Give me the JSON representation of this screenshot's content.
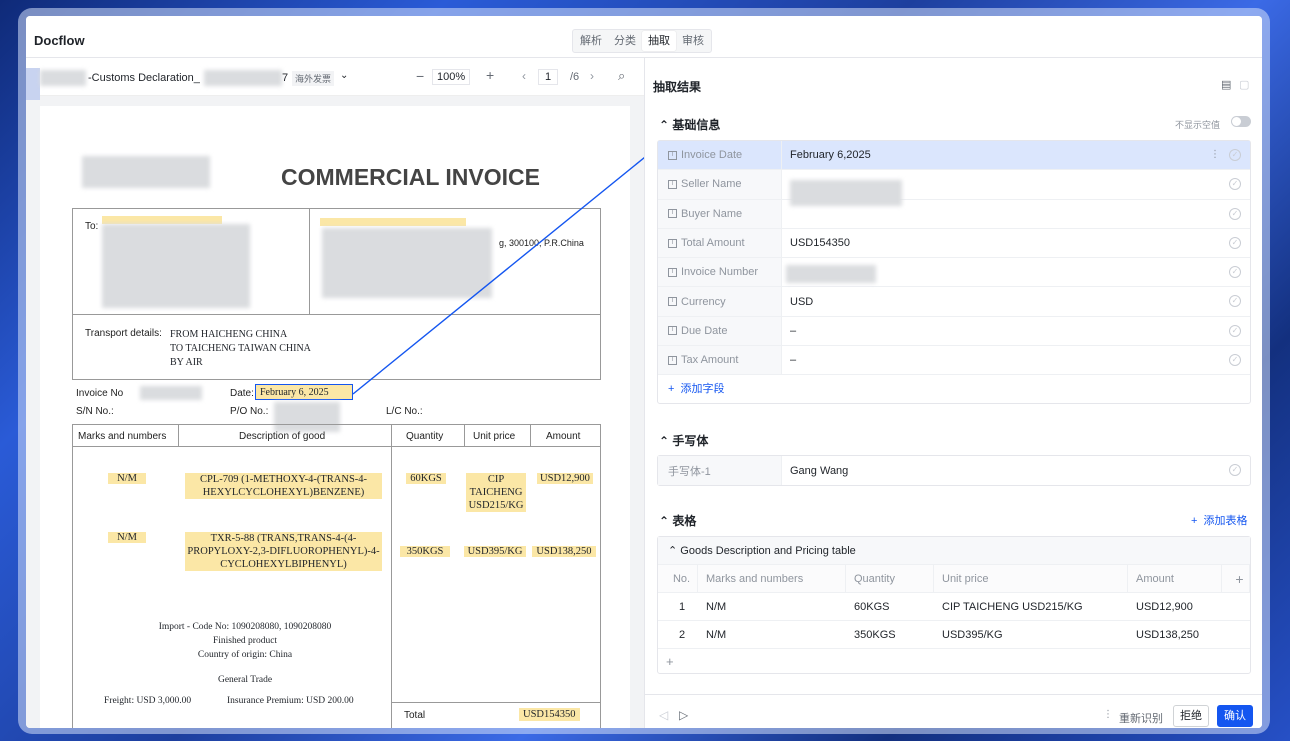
{
  "app": {
    "title": "Docflow",
    "tabs": [
      "解析",
      "分类",
      "抽取",
      "审核"
    ],
    "active_tab": "抽取"
  },
  "viewer": {
    "file_name": "-Customs Declaration_",
    "file_suffix": "7",
    "tag": "海外发票",
    "zoom": "100%",
    "page_current": "1",
    "page_total": "/6"
  },
  "invoice": {
    "title": "COMMERCIAL INVOICE",
    "to_label": "To:",
    "address_fragment": "g, 300100, P.R.China",
    "transport_label": "Transport details:",
    "transport_lines": [
      "FROM HAICHENG CHINA",
      "TO TAICHENG TAIWAN CHINA",
      "BY AIR"
    ],
    "invoice_no_label": "Invoice No",
    "date_label": "Date:",
    "date_value": "February 6, 2025",
    "sn_label": "S/N No.:",
    "po_label": "P/O No.:",
    "lc_label": "L/C No.:",
    "headers": [
      "Marks and numbers",
      "Description of good",
      "Quantity",
      "Unit price",
      "Amount"
    ],
    "items": [
      {
        "marks": "N/M",
        "desc": "CPL-709 (1-METHOXY-4-(TRANS-4-HEXYLCYCLOHEXYL)BENZENE)",
        "qty": "60KGS",
        "price": "CIP TAICHENG USD215/KG",
        "amount": "USD12,900"
      },
      {
        "marks": "N/M",
        "desc": "TXR-5-88 (TRANS,TRANS-4-(4-PROPYLOXY-2,3-DIFLUOROPHENYL)-4-CYCLOHEXYLBIPHENYL)",
        "qty": "350KGS",
        "price": "USD395/KG",
        "amount": "USD138,250"
      }
    ],
    "notes": [
      "Import - Code No: 1090208080, 1090208080",
      "Finished product",
      "Country of origin: China",
      "General Trade"
    ],
    "freight": "Freight: USD 3,000.00",
    "insurance": "Insurance Premium: USD 200.00",
    "total_label": "Total",
    "total_value": "USD154350"
  },
  "panel": {
    "title": "抽取结果",
    "basic_section": "基础信息",
    "hide_empty": "不显示空值",
    "fields": [
      {
        "label": "Invoice Date",
        "value": "February 6,2025"
      },
      {
        "label": "Seller Name",
        "value": ""
      },
      {
        "label": "Buyer Name",
        "value": ""
      },
      {
        "label": "Total Amount",
        "value": "USD154350"
      },
      {
        "label": "Invoice Number",
        "value": ""
      },
      {
        "label": "Currency",
        "value": "USD"
      },
      {
        "label": "Due Date",
        "value": "–"
      },
      {
        "label": "Tax Amount",
        "value": "–"
      }
    ],
    "add_field": "添加字段",
    "handwriting_section": "手写体",
    "handwriting": {
      "label": "手写体-1",
      "value": "Gang Wang"
    },
    "table_section": "表格",
    "add_table": "添加表格",
    "table_title": "Goods Description and Pricing table",
    "table_headers": [
      "No.",
      "Marks and numbers",
      "Quantity",
      "Unit price",
      "Amount"
    ],
    "table_rows": [
      [
        "1",
        "N/M",
        "60KGS",
        "CIP TAICHENG USD215/KG",
        "USD12,900"
      ],
      [
        "2",
        "N/M",
        "350KGS",
        "USD395/KG",
        "USD138,250"
      ]
    ],
    "footer": {
      "reprocess": "重新识别",
      "reject": "拒绝",
      "confirm": "确认"
    }
  }
}
